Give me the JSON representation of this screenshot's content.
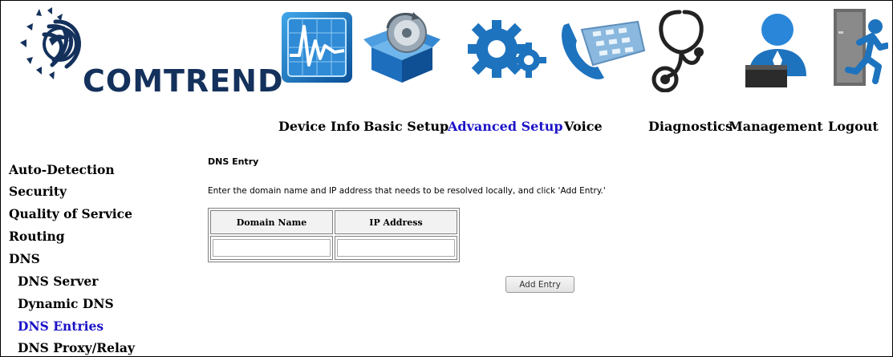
{
  "header": {
    "brand": "COMTREND",
    "nav": [
      {
        "label": "Device Info",
        "icon": "device-info-chart-icon"
      },
      {
        "label": "Basic Setup",
        "icon": "basic-setup-box-icon"
      },
      {
        "label": "Advanced Setup",
        "icon": "advanced-setup-gears-icon",
        "active": true
      },
      {
        "label": "Voice",
        "icon": "voice-phone-icon"
      },
      {
        "label": "Diagnostics",
        "icon": "diagnostics-stethoscope-icon"
      },
      {
        "label": "Management",
        "icon": "management-person-icon"
      },
      {
        "label": "Logout",
        "icon": "logout-door-icon"
      }
    ]
  },
  "sidebar": {
    "items": [
      {
        "label": "Auto-Detection"
      },
      {
        "label": "Security"
      },
      {
        "label": "Quality of Service"
      },
      {
        "label": "Routing"
      },
      {
        "label": "DNS"
      },
      {
        "label": "DNS Server",
        "sub": true
      },
      {
        "label": "Dynamic DNS",
        "sub": true
      },
      {
        "label": "DNS Entries",
        "sub": true,
        "active": true
      },
      {
        "label": "DNS Proxy/Relay",
        "sub": true
      }
    ]
  },
  "main": {
    "title": "DNS Entry",
    "description": "Enter the domain name and IP address that needs to be resolved locally, and click 'Add Entry.'",
    "table": {
      "headers": [
        "Domain Name",
        "IP Address"
      ],
      "domain_value": "",
      "ip_value": ""
    },
    "add_button": "Add Entry"
  },
  "colors": {
    "brand_navy": "#14315c",
    "active_link": "#1c13c7",
    "icon_blue": "#1e73be"
  }
}
